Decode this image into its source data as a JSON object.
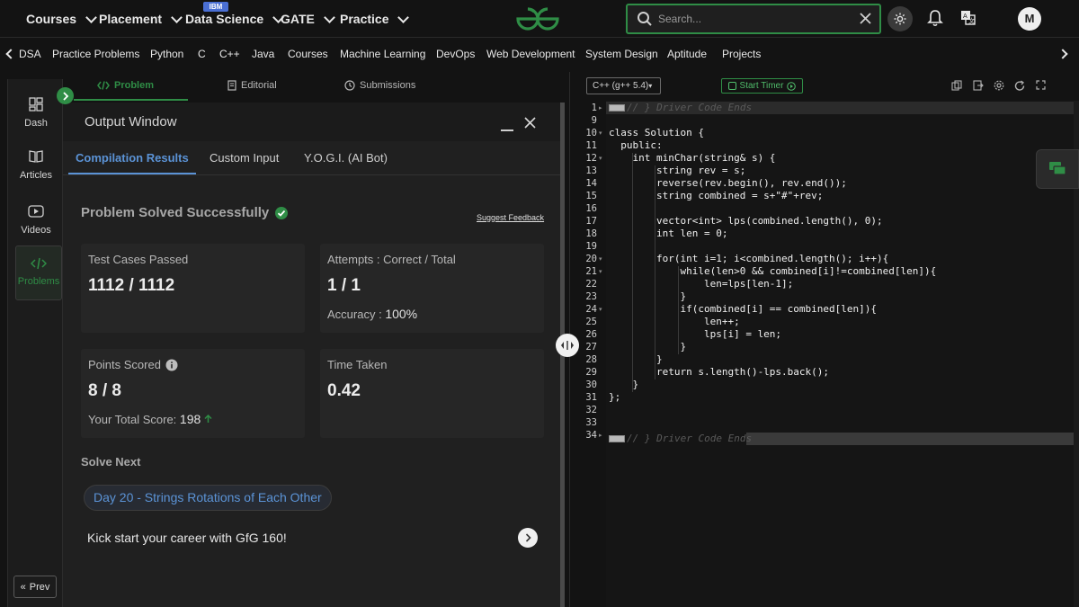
{
  "topnav": {
    "menus": [
      "Courses",
      "Placement",
      "Data Science",
      "GATE",
      "Practice"
    ],
    "ibm_badge": "IBM",
    "search_placeholder": "Search...",
    "avatar_initial": "M"
  },
  "subnav": {
    "items": [
      "DSA",
      "Practice Problems",
      "Python",
      "C",
      "C++",
      "Java",
      "Courses",
      "Machine Learning",
      "DevOps",
      "Web Development",
      "System Design",
      "Aptitude",
      "Projects"
    ]
  },
  "sidebar": {
    "items": [
      {
        "label": "Dash",
        "icon": "dashboard-icon"
      },
      {
        "label": "Articles",
        "icon": "book-icon"
      },
      {
        "label": "Videos",
        "icon": "video-icon"
      },
      {
        "label": "Problems",
        "icon": "code-icon",
        "active": true
      }
    ],
    "prev_label": "Prev"
  },
  "problem_tabs": {
    "problem": "Problem",
    "editorial": "Editorial",
    "submissions": "Submissions"
  },
  "output_window": {
    "title": "Output Window",
    "tabs": [
      "Compilation Results",
      "Custom Input",
      "Y.O.G.I. (AI Bot)"
    ],
    "status": "Problem Solved Successfully",
    "feedback_link": "Suggest Feedback",
    "cards": {
      "test_cases": {
        "label": "Test Cases Passed",
        "value": "1112 / 1112"
      },
      "attempts": {
        "label": "Attempts : Correct / Total",
        "value": "1 / 1",
        "sub_label": "Accuracy :",
        "sub_value": "100%"
      },
      "points": {
        "label": "Points Scored",
        "value": "8 / 8",
        "sub_label": "Your Total Score:",
        "sub_value": "198"
      },
      "time": {
        "label": "Time Taken",
        "value": "0.42"
      }
    },
    "solve_next": "Solve Next",
    "next_problem": "Day 20 - Strings Rotations of Each Other",
    "kick_start": "Kick start your career with GfG 160!"
  },
  "editor": {
    "language": "C++ (g++ 5.4)",
    "timer_label": "Start Timer",
    "line_numbers": [
      "1",
      "9",
      "10",
      "11",
      "12",
      "13",
      "14",
      "15",
      "16",
      "17",
      "18",
      "19",
      "20",
      "21",
      "22",
      "23",
      "24",
      "25",
      "26",
      "27",
      "28",
      "29",
      "30",
      "31",
      "32",
      "33",
      "34"
    ],
    "code_lines": [
      "// } Driver Code Ends",
      "",
      "class Solution {",
      "  public:",
      "    int minChar(string& s) {",
      "        string rev = s;",
      "        reverse(rev.begin(), rev.end());",
      "        string combined = s+\"#\"+rev;",
      "",
      "        vector<int> lps(combined.length(), 0);",
      "        int len = 0;",
      "",
      "        for(int i=1; i<combined.length(); i++){",
      "            while(len>0 && combined[i]!=combined[len]){",
      "                len=lps[len-1];",
      "            }",
      "            if(combined[i] == combined[len]){",
      "                len++;",
      "                lps[i] = len;",
      "            }",
      "        }",
      "        return s.length()-lps.back();",
      "    }",
      "};",
      "",
      "",
      "// } Driver Code Ends"
    ]
  },
  "colors": {
    "brand_green": "#2f8d46",
    "link_blue": "#5b93d6"
  }
}
